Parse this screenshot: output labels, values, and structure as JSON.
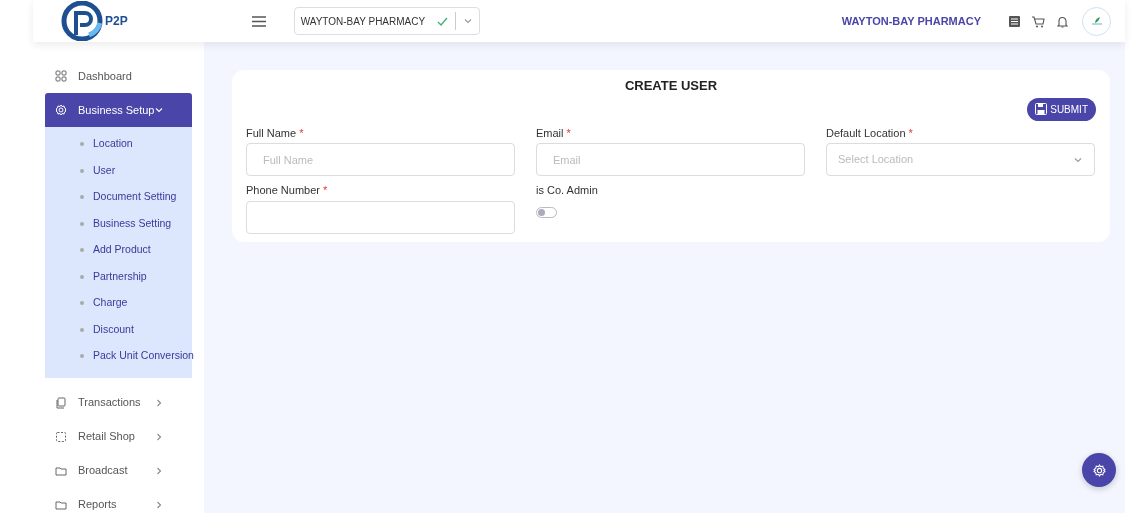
{
  "header": {
    "logo_text": "P2P",
    "company_select": {
      "value": "WAYTON-BAY PHARMACY",
      "valid": true
    },
    "company_name": "WAYTON-BAY PHARMACY"
  },
  "sidebar": {
    "items": [
      {
        "label": "Dashboard",
        "kind": "link",
        "selected": false
      },
      {
        "label": "Business Setup",
        "kind": "group",
        "selected": true,
        "expanded": true,
        "children": [
          {
            "label": "Location"
          },
          {
            "label": "User"
          },
          {
            "label": "Document Setting"
          },
          {
            "label": "Business Setting"
          },
          {
            "label": "Add Product"
          },
          {
            "label": "Partnership"
          },
          {
            "label": "Charge"
          },
          {
            "label": "Discount"
          },
          {
            "label": "Pack Unit Conversion"
          }
        ]
      },
      {
        "label": "Transactions",
        "kind": "group",
        "selected": false,
        "expanded": false
      },
      {
        "label": "Retail Shop",
        "kind": "group",
        "selected": false,
        "expanded": false
      },
      {
        "label": "Broadcast",
        "kind": "group",
        "selected": false,
        "expanded": false
      },
      {
        "label": "Reports",
        "kind": "group",
        "selected": false,
        "expanded": false
      }
    ]
  },
  "form": {
    "title": "CREATE USER",
    "submit": "SUBMIT",
    "fields": [
      {
        "kind": "text",
        "label": "Full Name",
        "required_mark": "*",
        "placeholder": "Full Name"
      },
      {
        "kind": "text",
        "label": "Email",
        "required_mark": "*",
        "placeholder": "Email"
      },
      {
        "kind": "select",
        "label": "Default Location",
        "required_mark": "*",
        "placeholder": "Select Location"
      },
      {
        "kind": "text",
        "label": "Phone Number",
        "required_mark": "*"
      },
      {
        "kind": "switch",
        "label": "is Co. Admin",
        "on": false
      }
    ]
  }
}
